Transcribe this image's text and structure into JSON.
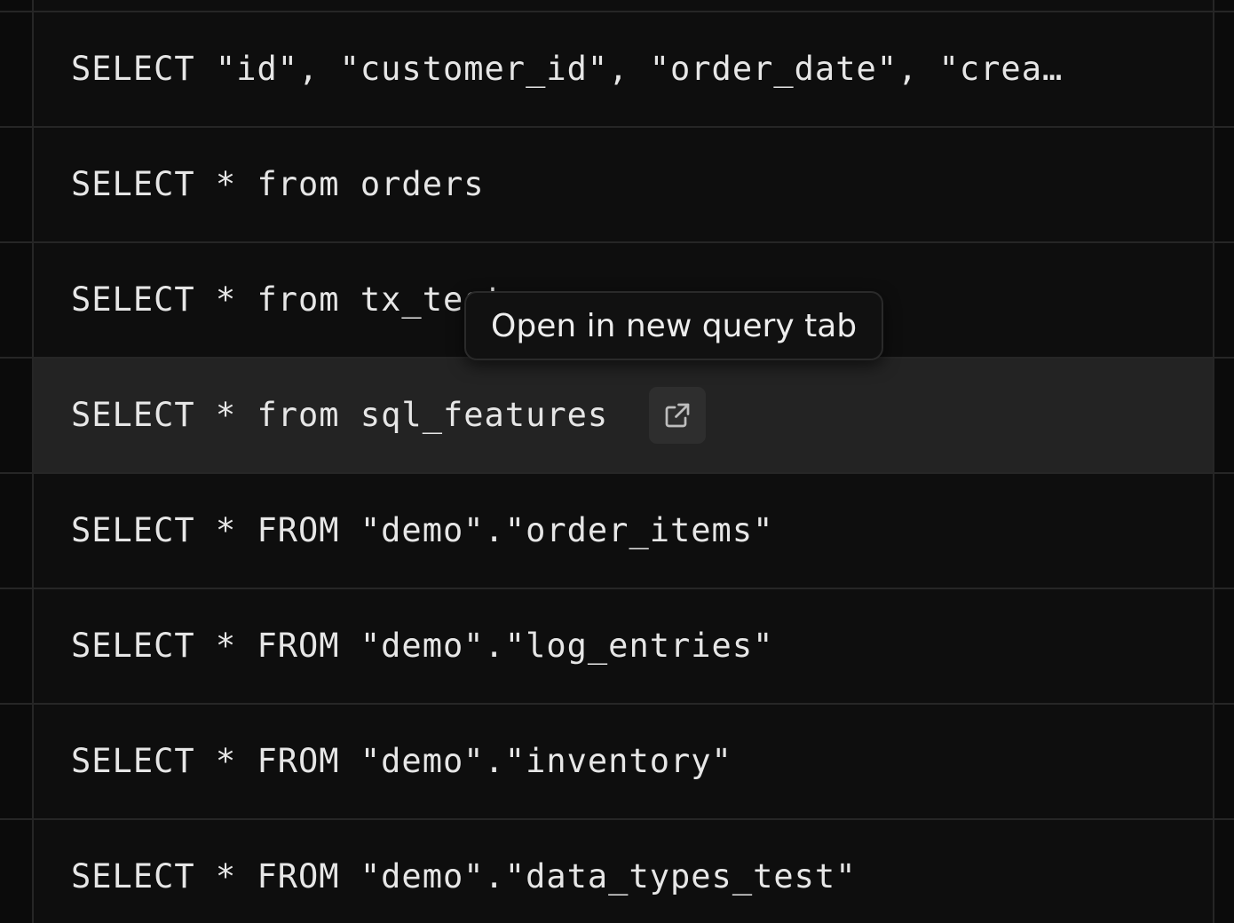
{
  "queries": [
    {
      "text": "SELECT \"id\", \"customer_id\", \"order_date\", \"crea…"
    },
    {
      "text": "SELECT * from orders"
    },
    {
      "text": "SELECT * from tx_test"
    },
    {
      "text": "SELECT * from sql_features"
    },
    {
      "text": "SELECT * FROM \"demo\".\"order_items\""
    },
    {
      "text": "SELECT * FROM \"demo\".\"log_entries\""
    },
    {
      "text": "SELECT * FROM \"demo\".\"inventory\""
    },
    {
      "text": "SELECT * FROM \"demo\".\"data_types_test\""
    }
  ],
  "tooltip": {
    "label": "Open in new query tab"
  },
  "icons": {
    "open_in_new": "external-link-icon"
  },
  "colors": {
    "background": "#0e0e0e",
    "highlight": "#232323",
    "text": "#e6e6e6",
    "tooltip_bg": "#111111",
    "button_bg": "#2e2e2e"
  }
}
